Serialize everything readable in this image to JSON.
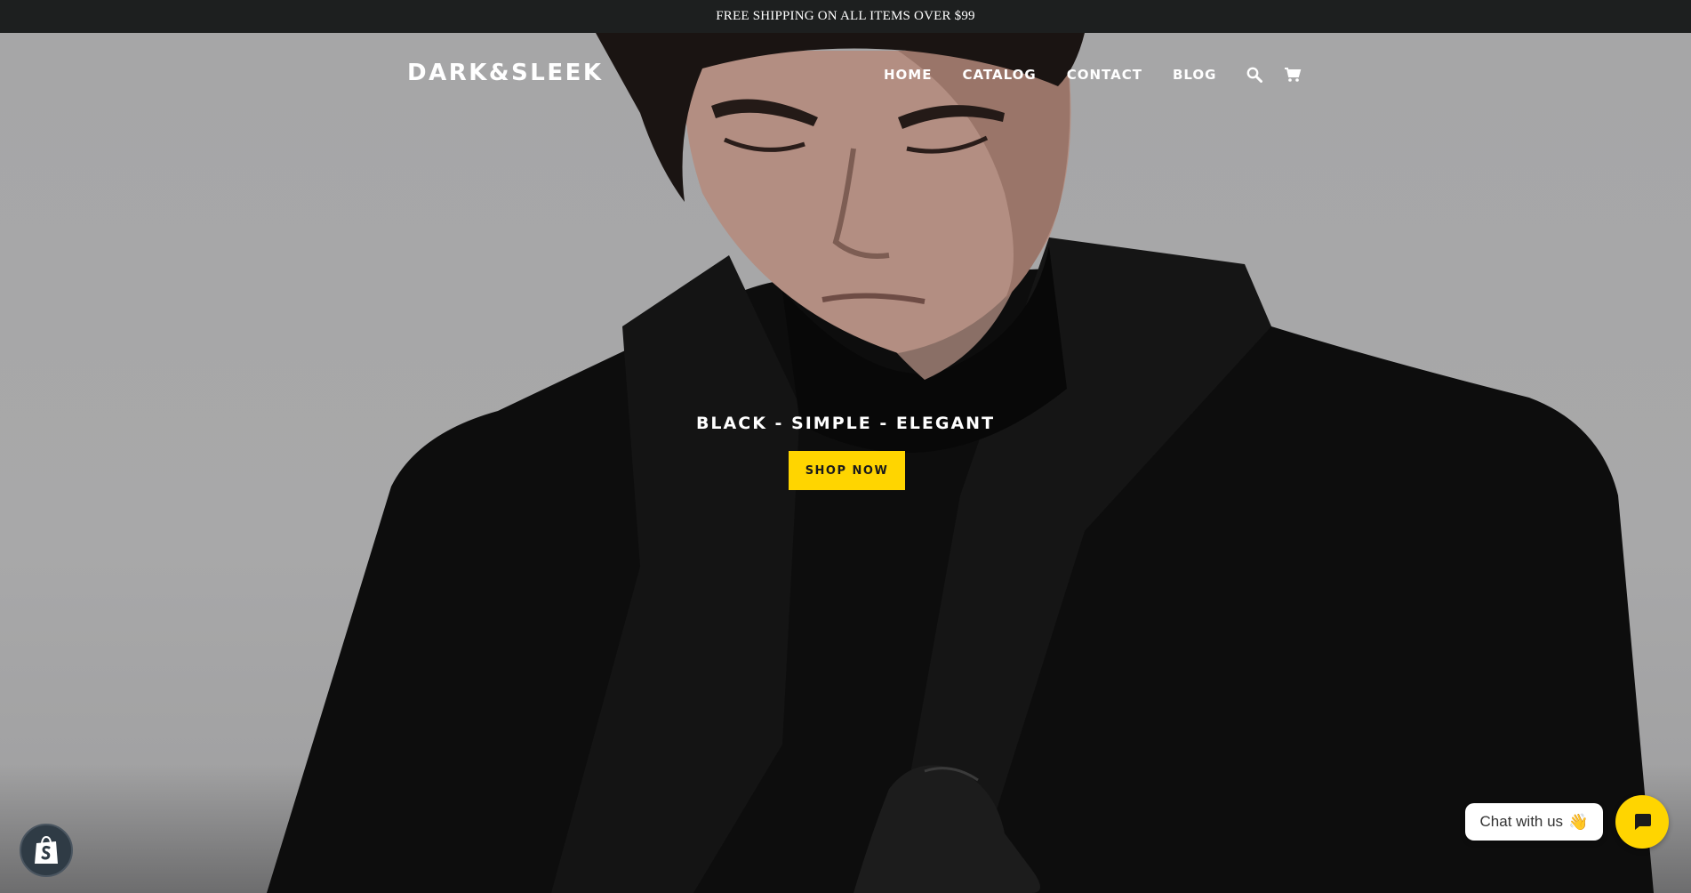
{
  "announcement": {
    "text": "FREE SHIPPING ON ALL ITEMS OVER $99"
  },
  "header": {
    "logo": "DARK&SLEEK",
    "nav": [
      {
        "label": "HOME"
      },
      {
        "label": "CATALOG"
      },
      {
        "label": "CONTACT"
      },
      {
        "label": "BLOG"
      }
    ],
    "icons": [
      "search-icon",
      "cart-icon"
    ]
  },
  "hero": {
    "tagline": "BLACK - SIMPLE - ELEGANT",
    "cta_label": "SHOP NOW"
  },
  "chat": {
    "bubble_text": "Chat with us",
    "bubble_emoji": "👋",
    "launcher_icon": "chat-icon"
  },
  "badge": {
    "icon": "shopify-bag-icon"
  },
  "colors": {
    "announcement_bg": "#1d1f1f",
    "hero_bg": "#a9a9aa",
    "accent": "#ffd500",
    "text_light": "#ffffff"
  }
}
